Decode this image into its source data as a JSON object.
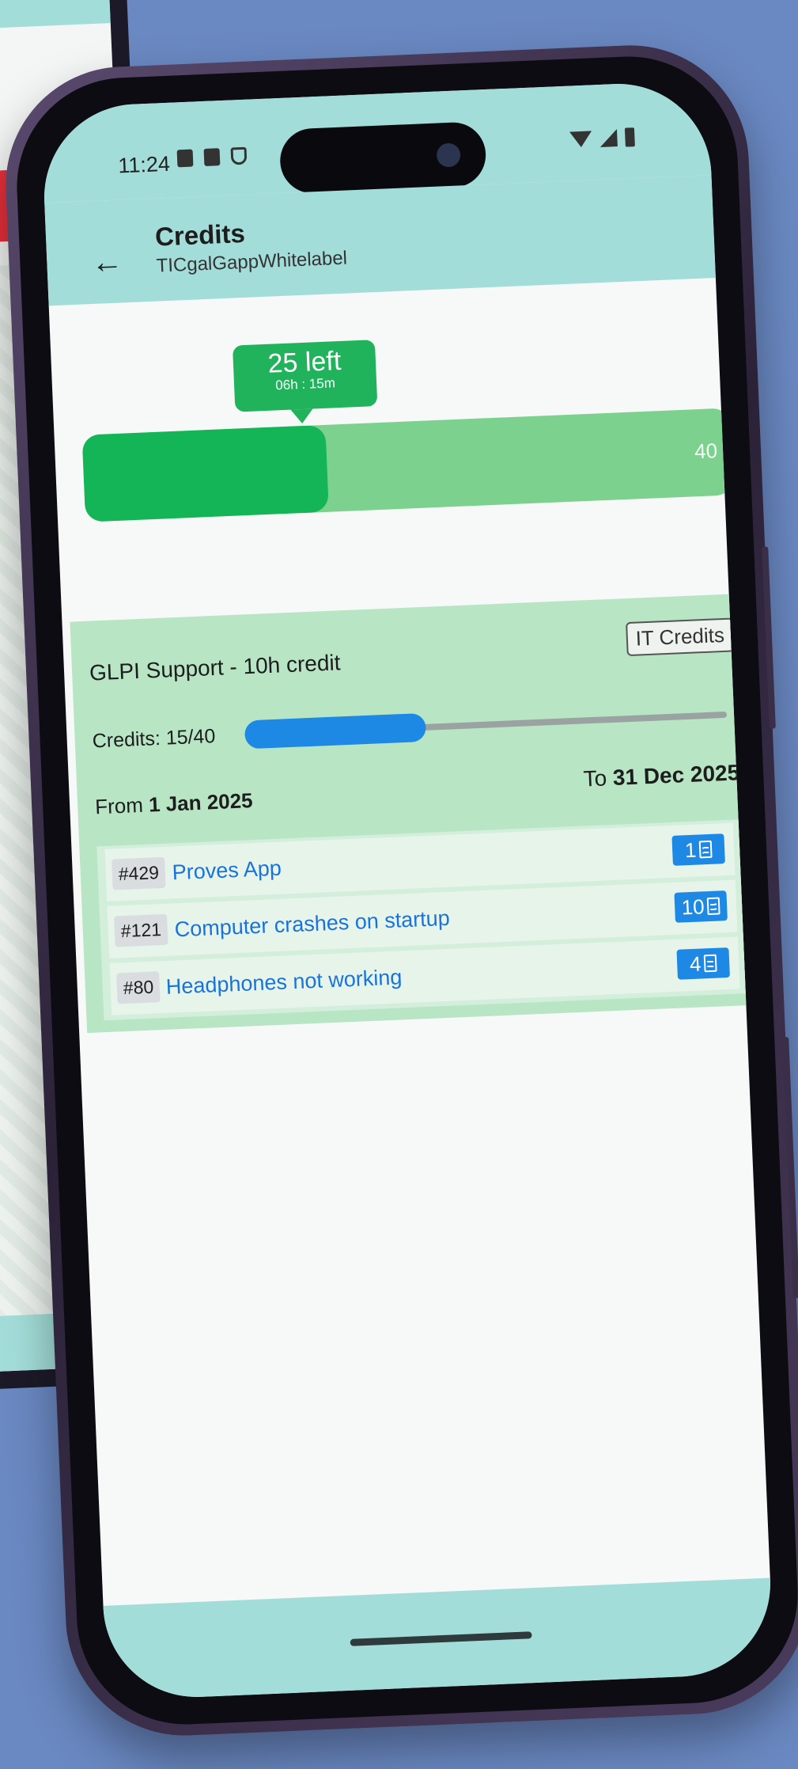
{
  "status_bar": {
    "time": "11:24"
  },
  "app_bar": {
    "title": "Credits",
    "subtitle": "TICgalGappWhitelabel"
  },
  "usage": {
    "left_label": "25 left",
    "time_label": "06h : 15m",
    "total": "40",
    "fraction_used": 0.375
  },
  "contract": {
    "name": "GLPI Support - 10h credit",
    "badge": "IT Credits",
    "credits_label": "Credits: 15/40",
    "credits_fraction": 0.375,
    "from_label": "From ",
    "from_date": "1 Jan 2025",
    "to_label": "To ",
    "to_date": "31 Dec 2025",
    "tickets": [
      {
        "id": "#429",
        "title": "Proves App",
        "count": "1"
      },
      {
        "id": "#121",
        "title": "Computer crashes on startup",
        "count": "10"
      },
      {
        "id": "#80",
        "title": "Headphones not working",
        "count": "4"
      }
    ]
  },
  "colors": {
    "app_bar": "#a3ddd9",
    "bar_fill": "#14b557",
    "bar_track": "#7dd18f",
    "card": "#b8e6c5",
    "accent_blue": "#1e88e5",
    "background": "#6a88c2"
  }
}
